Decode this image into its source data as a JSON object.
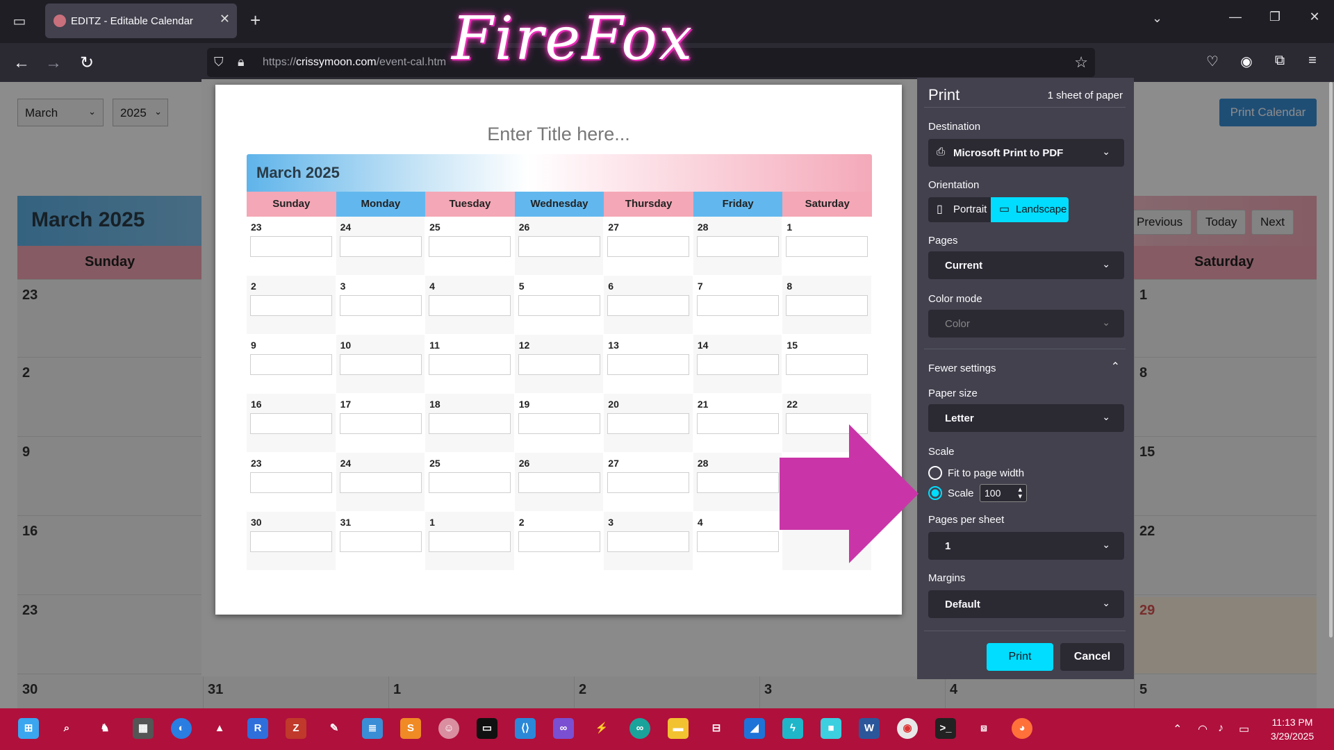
{
  "browser": {
    "tab_title": "EDITZ - Editable Calendar",
    "url_scheme": "https://",
    "url_host": "crissymoon.com",
    "url_path": "/event-cal.htm",
    "overlay_text": "FireFox"
  },
  "page": {
    "month_select": "March",
    "year_select": "2025",
    "print_calendar_label": "Print Calendar",
    "header_title": "March 2025",
    "nav_previous": "Previous",
    "nav_today": "Today",
    "nav_next": "Next",
    "day_left": "Sunday",
    "day_right": "Saturday",
    "left_col_numbers": [
      "23",
      "2",
      "9",
      "16",
      "23",
      "30"
    ],
    "right_col_numbers": [
      "1",
      "8",
      "15",
      "22",
      "29",
      "5"
    ],
    "bottom_row_numbers": [
      "31",
      "1",
      "2",
      "3",
      "4"
    ]
  },
  "preview": {
    "title_placeholder": "Enter Title here...",
    "month_title": "March 2025",
    "days": [
      "Sunday",
      "Monday",
      "Tuesday",
      "Wednesday",
      "Thursday",
      "Friday",
      "Saturday"
    ],
    "weeks": [
      [
        "23",
        "24",
        "25",
        "26",
        "27",
        "28",
        "1"
      ],
      [
        "2",
        "3",
        "4",
        "5",
        "6",
        "7",
        "8"
      ],
      [
        "9",
        "10",
        "11",
        "12",
        "13",
        "14",
        "15"
      ],
      [
        "16",
        "17",
        "18",
        "19",
        "20",
        "21",
        "22"
      ],
      [
        "23",
        "24",
        "25",
        "26",
        "27",
        "28",
        ""
      ],
      [
        "30",
        "31",
        "1",
        "2",
        "3",
        "4",
        ""
      ]
    ]
  },
  "print_panel": {
    "title": "Print",
    "sheets": "1 sheet of paper",
    "destination_label": "Destination",
    "destination_value": "Microsoft Print to PDF",
    "orientation_label": "Orientation",
    "portrait_label": "Portrait",
    "landscape_label": "Landscape",
    "pages_label": "Pages",
    "pages_value": "Current",
    "color_mode_label": "Color mode",
    "color_mode_value": "Color",
    "fewer_settings_label": "Fewer settings",
    "paper_size_label": "Paper size",
    "paper_size_value": "Letter",
    "scale_label": "Scale",
    "fit_to_width_label": "Fit to page width",
    "scale_option_label": "Scale",
    "scale_value": "100",
    "pages_per_sheet_label": "Pages per sheet",
    "pages_per_sheet_value": "1",
    "margins_label": "Margins",
    "margins_value": "Default",
    "print_button": "Print",
    "cancel_button": "Cancel"
  },
  "taskbar": {
    "time": "11:13 PM",
    "date": "3/29/2025"
  },
  "colors": {
    "accent_cyan": "#00ddff",
    "arrow_magenta": "#c935a8",
    "taskbar": "#b0103c",
    "day_pink": "#f4a7b6",
    "day_blue": "#62b8ee"
  }
}
